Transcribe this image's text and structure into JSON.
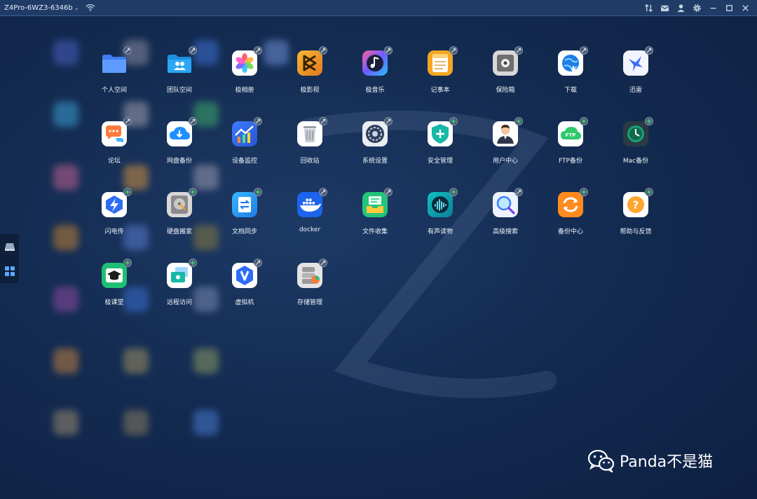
{
  "titlebar": {
    "device_name": "Z4Pro-6WZ3-6346b",
    "icons": [
      "wifi-icon",
      "transfer-icon",
      "mail-icon",
      "user-icon",
      "settings-icon",
      "minimize-icon",
      "maximize-icon",
      "close-icon"
    ]
  },
  "sidedock": {
    "items": [
      "storage-drive-icon",
      "apps-grid-icon"
    ]
  },
  "apps": [
    {
      "label": "个人空间",
      "icon": "folder-icon",
      "badge": "installed"
    },
    {
      "label": "团队空间",
      "icon": "team-folder-icon",
      "badge": "installed"
    },
    {
      "label": "极相册",
      "icon": "photos-icon",
      "badge": "installed"
    },
    {
      "label": "极影视",
      "icon": "video-icon",
      "badge": "installed"
    },
    {
      "label": "极音乐",
      "icon": "music-icon",
      "badge": "installed"
    },
    {
      "label": "记事本",
      "icon": "notepad-icon",
      "badge": "installed"
    },
    {
      "label": "保险箱",
      "icon": "safe-icon",
      "badge": "installed"
    },
    {
      "label": "下载",
      "icon": "download-globe-icon",
      "badge": "installed"
    },
    {
      "label": "迅雷",
      "icon": "thunder-icon",
      "badge": "installed"
    },
    {
      "label": "论坛",
      "icon": "forum-icon",
      "badge": "installed"
    },
    {
      "label": "网盘备份",
      "icon": "cloud-backup-icon",
      "badge": "installed"
    },
    {
      "label": "设备监控",
      "icon": "monitor-icon",
      "badge": "installed"
    },
    {
      "label": "回收站",
      "icon": "trash-icon",
      "badge": "installed"
    },
    {
      "label": "系统设置",
      "icon": "system-settings-icon",
      "badge": "installed"
    },
    {
      "label": "安全管理",
      "icon": "security-shield-icon",
      "badge": "add"
    },
    {
      "label": "用户中心",
      "icon": "user-center-icon",
      "badge": "add"
    },
    {
      "label": "FTP备份",
      "icon": "ftp-cloud-icon",
      "badge": "add"
    },
    {
      "label": "Mac备份",
      "icon": "time-machine-icon",
      "badge": "add"
    },
    {
      "label": "闪电传",
      "icon": "lightning-transfer-icon",
      "badge": "add"
    },
    {
      "label": "硬盘搬家",
      "icon": "disk-move-icon",
      "badge": "add"
    },
    {
      "label": "文档同步",
      "icon": "doc-sync-icon",
      "badge": "add"
    },
    {
      "label": "docker",
      "icon": "docker-icon",
      "badge": "installed"
    },
    {
      "label": "文件收集",
      "icon": "file-collect-icon",
      "badge": "installed"
    },
    {
      "label": "有声读物",
      "icon": "audiobook-icon",
      "badge": "add"
    },
    {
      "label": "高级搜索",
      "icon": "advanced-search-icon",
      "badge": "installed"
    },
    {
      "label": "备份中心",
      "icon": "backup-center-icon",
      "badge": "add"
    },
    {
      "label": "帮助与反馈",
      "icon": "help-icon",
      "badge": "add"
    },
    {
      "label": "极课堂",
      "icon": "classroom-icon",
      "badge": "add"
    },
    {
      "label": "远程访问",
      "icon": "remote-access-icon",
      "badge": "add"
    },
    {
      "label": "虚拟机",
      "icon": "vm-icon",
      "badge": "installed"
    },
    {
      "label": "存储管理",
      "icon": "storage-manager-icon",
      "badge": "installed"
    }
  ],
  "watermark": {
    "text": "Panda不是猫",
    "icon": "wechat-icon"
  },
  "colors": {
    "background": "#142c52",
    "titlebar": "#1f3b66",
    "add_badge": "#3ed26b"
  }
}
